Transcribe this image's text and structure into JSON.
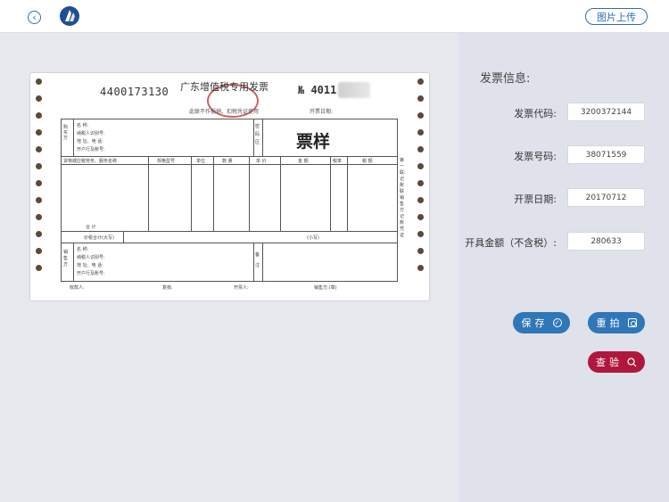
{
  "header": {
    "upload_label": "图片上传"
  },
  "invoice_image": {
    "code": "4400173130",
    "title": "广东增值税专用发票",
    "number_prefix": "№ 4011",
    "sample_mark": "票样",
    "subtitle": "此联不作报销、扣税凭证使用",
    "date_label": "开票日期:",
    "buyer_label": "购买方",
    "seller_label": "销售方",
    "name_label": "名 称:",
    "taxid_label": "纳税人识别号:",
    "address_label": "地 址、电 话:",
    "bank_label": "开户行及账号:",
    "password_label": "密码区",
    "col_item": "货物或应税劳务、服务名称",
    "col_spec": "规格型号",
    "col_unit": "单位",
    "col_qty": "数 量",
    "col_price": "单 价",
    "col_amount": "金 额",
    "col_rate": "税率",
    "col_tax": "税 额",
    "total_label": "合 计",
    "total_words_label": "价税合计(大写)",
    "total_small_label": "(小写)",
    "remark_label": "备注",
    "payee_label": "收款人:",
    "reviewer_label": "复核:",
    "drawer_label": "开票人:",
    "seller_sign_label": "销售方:(章)",
    "side_note": "第一联:记账联 销售方记账凭证"
  },
  "form": {
    "title": "发票信息:",
    "fields": [
      {
        "label": "发票代码:",
        "value": "3200372144"
      },
      {
        "label": "发票号码:",
        "value": "38071559"
      },
      {
        "label": "开票日期:",
        "value": "20170712"
      },
      {
        "label": "开具金额（不含税）:",
        "value": "280633"
      }
    ]
  },
  "actions": {
    "save_label": "保存",
    "retake_label": "重拍",
    "verify_label": "查验"
  },
  "colors": {
    "accent": "#2e6db3",
    "primary_button": "#3077b8",
    "verify_button": "#b0173f"
  },
  "icons": {
    "back": "back-icon",
    "logo": "logo-icon",
    "save": "check-circle-icon",
    "retake": "camera-icon",
    "verify": "search-icon"
  }
}
